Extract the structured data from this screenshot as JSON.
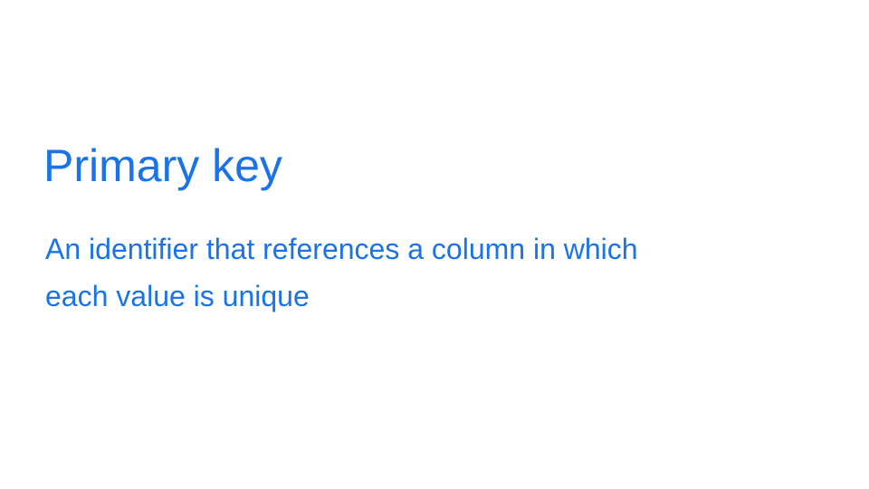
{
  "slide": {
    "title": "Primary key",
    "definition_line1": "An identifier that references a column in which",
    "definition_line2": "each value is unique"
  },
  "colors": {
    "text": "#1a73e8",
    "background": "#ffffff"
  }
}
